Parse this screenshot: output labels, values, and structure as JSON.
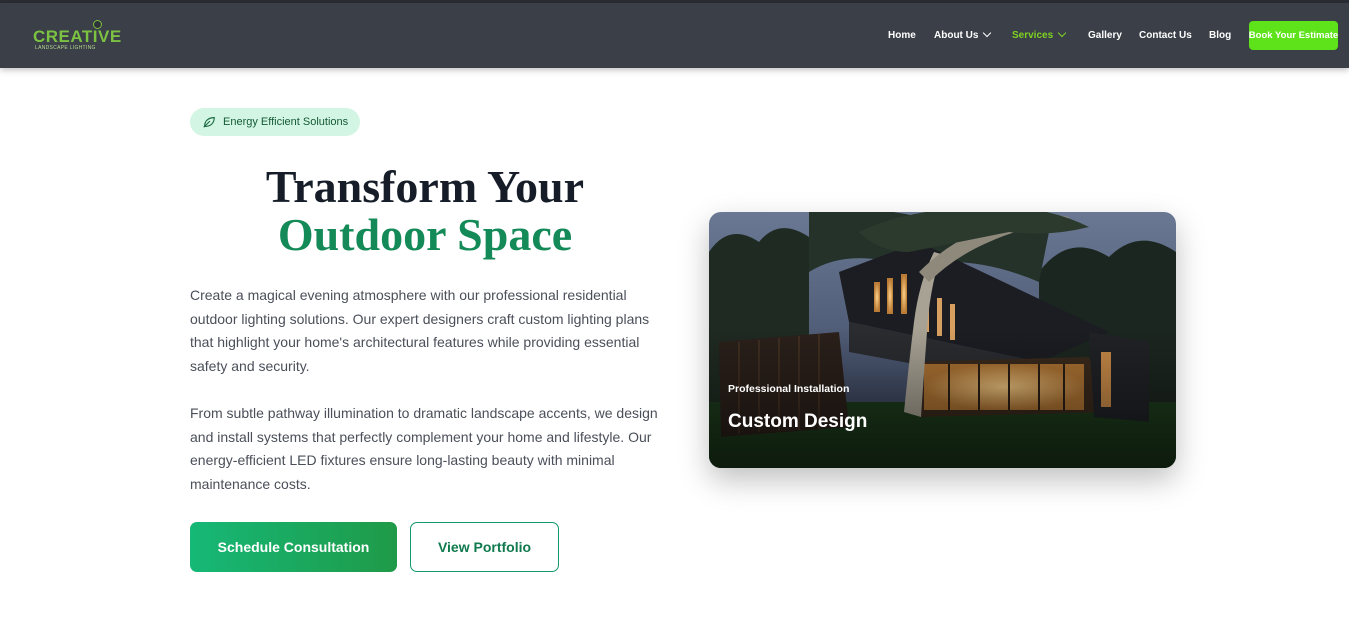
{
  "brand": {
    "logo_text": "CREATIVE",
    "logo_tagline": "LANDSCAPE LIGHTING",
    "accent": "#7ed321"
  },
  "nav": {
    "items": [
      {
        "label": "Home"
      },
      {
        "label": "About Us"
      },
      {
        "label": "Services"
      },
      {
        "label": "Gallery"
      },
      {
        "label": "Contact Us"
      },
      {
        "label": "Blog"
      }
    ],
    "cta_label": "Book Your Estimate"
  },
  "hero": {
    "badge": "Energy Efficient Solutions",
    "title_line1": "Transform Your",
    "title_line2": "Outdoor Space",
    "paragraph1": "Create a magical evening atmosphere with our professional residential outdoor lighting solutions. Our expert designers craft custom lighting plans that highlight your home's architectural features while providing essential safety and security.",
    "paragraph2": "From subtle pathway illumination to dramatic landscape accents, we design and install systems that perfectly complement your home and lifestyle. Our energy-efficient LED fixtures ensure long-lasting beauty with minimal maintenance costs.",
    "primary_button": "Schedule Consultation",
    "secondary_button": "View Portfolio"
  },
  "card": {
    "kicker": "Professional Installation",
    "title": "Custom Design"
  }
}
